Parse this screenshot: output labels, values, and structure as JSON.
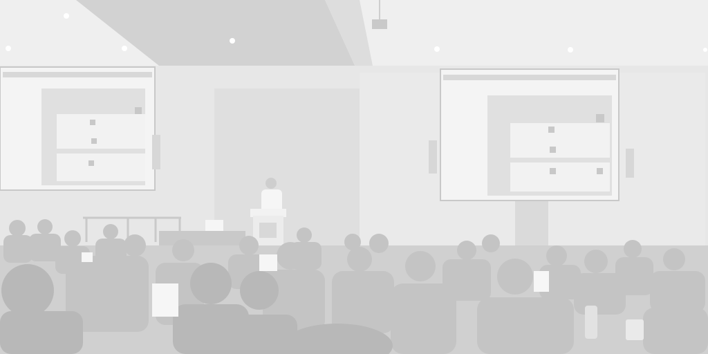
{
  "scene": {
    "description_type": "photo",
    "palette": {
      "ceiling": "#ececec",
      "ceiling_shadow": "#c9c9c9",
      "wall": "#e2e2e2",
      "wall_dark": "#d4d4d4",
      "screen": "#efefef",
      "screen_ui": "#cfcfcf",
      "audience": "#b9b9b9",
      "audience_dark": "#a6a6a6",
      "light": "#ffffff"
    }
  }
}
